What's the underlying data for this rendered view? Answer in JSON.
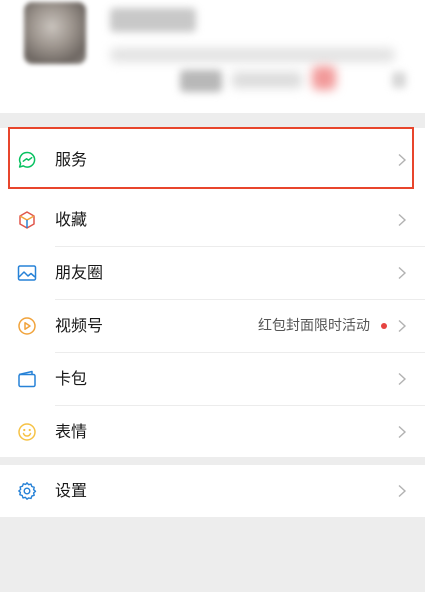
{
  "menu": {
    "items": [
      {
        "label": "服务",
        "icon": "service-icon"
      },
      {
        "label": "收藏",
        "icon": "favorites-cube-icon"
      },
      {
        "label": "朋友圈",
        "icon": "moments-picture-icon"
      },
      {
        "label": "视频号",
        "icon": "channels-play-icon",
        "extra": "红包封面限时活动",
        "badge": "red-dot"
      },
      {
        "label": "卡包",
        "icon": "card-wallet-icon"
      },
      {
        "label": "表情",
        "icon": "sticker-smile-icon"
      }
    ],
    "settings": {
      "label": "设置",
      "icon": "settings-gear-icon"
    }
  },
  "colors": {
    "background": "#ededed",
    "service_icon": "#07c160",
    "moments_icon": "#2782d7",
    "channels_icon": "#f1a33b",
    "card_icon": "#2782d7",
    "sticker_icon": "#f6c245",
    "settings_icon": "#2782d7",
    "highlight": "#e8452c",
    "badge": "#e64340"
  }
}
